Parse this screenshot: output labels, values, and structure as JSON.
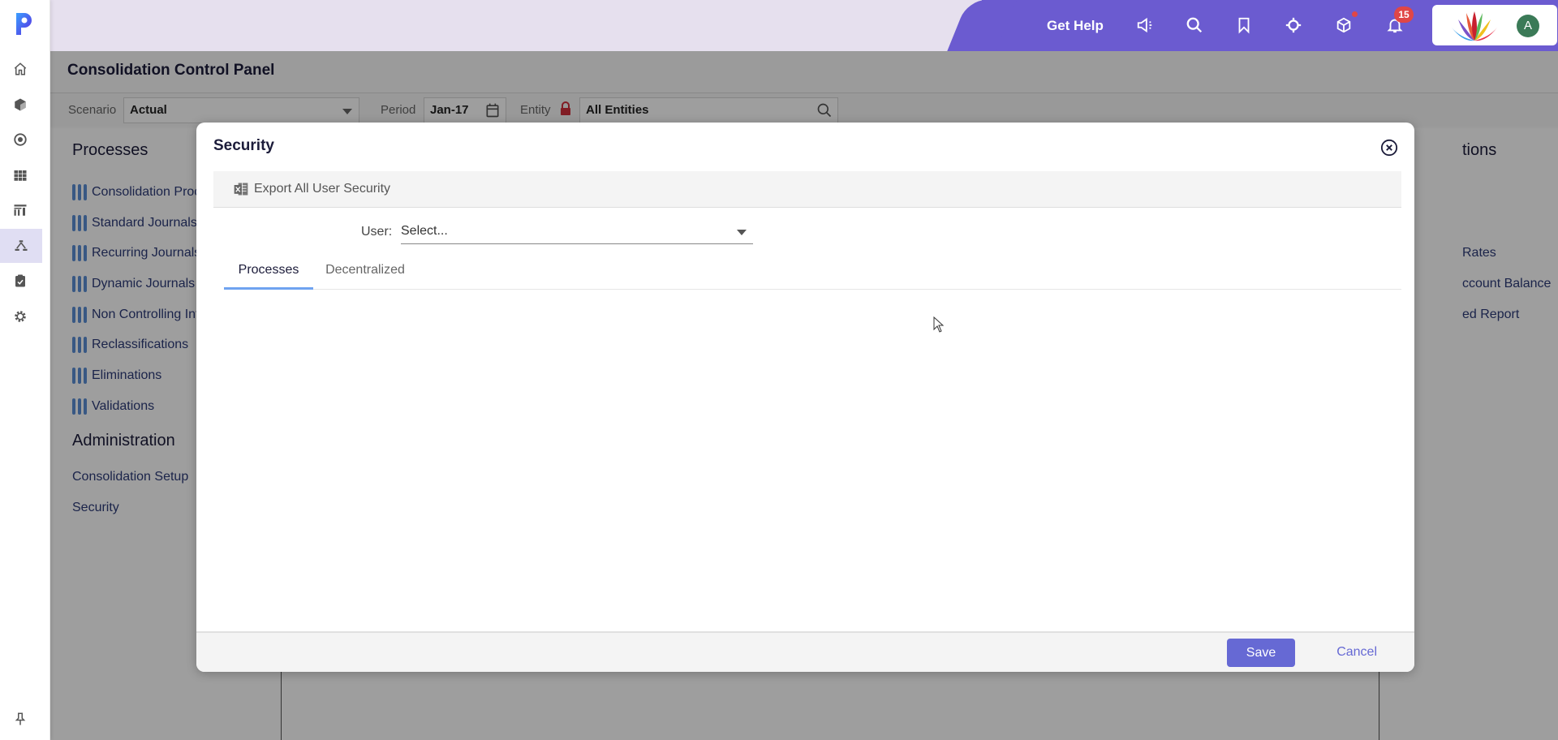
{
  "rail": {
    "items": [
      {
        "icon": "home-icon"
      },
      {
        "icon": "cube-icon"
      },
      {
        "icon": "target-circle-icon"
      },
      {
        "icon": "grid-icon"
      },
      {
        "icon": "dashboard-icon"
      },
      {
        "icon": "hierarchy-icon",
        "active": true
      },
      {
        "icon": "clipboard-check-icon"
      },
      {
        "icon": "gear-icon"
      }
    ],
    "pin_icon": "pin-icon"
  },
  "topbar": {
    "get_help": "Get Help",
    "icons": [
      "megaphone-icon",
      "search-icon",
      "bookmark-icon",
      "crosshair-icon",
      "cube-icon",
      "bell-icon"
    ],
    "notification_count": "15",
    "avatar_initial": "A",
    "colors": {
      "accent": "#6b5bd0",
      "badge": "#e04646",
      "avatar": "#3b7a57"
    }
  },
  "page": {
    "title": "Consolidation Control Panel",
    "filters": {
      "scenario_label": "Scenario",
      "scenario_value": "Actual",
      "period_label": "Period",
      "period_value": "Jan-17",
      "entity_label": "Entity",
      "entity_value": "All Entities"
    },
    "processes_heading": "Processes",
    "processes": [
      "Consolidation Process",
      "Standard Journals",
      "Recurring Journals",
      "Dynamic Journals",
      "Non Controlling Interest",
      "Reclassifications",
      "Eliminations",
      "Validations"
    ],
    "administration_heading": "Administration",
    "administration": [
      "Consolidation Setup",
      "Security"
    ],
    "right_heading": "tions",
    "right_items": [
      "Rates",
      "ccount Balance",
      "ed Report"
    ]
  },
  "dialog": {
    "title": "Security",
    "export_label": "Export All User Security",
    "user_label": "User:",
    "user_placeholder": "Select...",
    "tabs": [
      {
        "label": "Processes",
        "active": true
      },
      {
        "label": "Decentralized",
        "active": false
      }
    ],
    "save_label": "Save",
    "cancel_label": "Cancel",
    "accent": "#6669d4"
  }
}
